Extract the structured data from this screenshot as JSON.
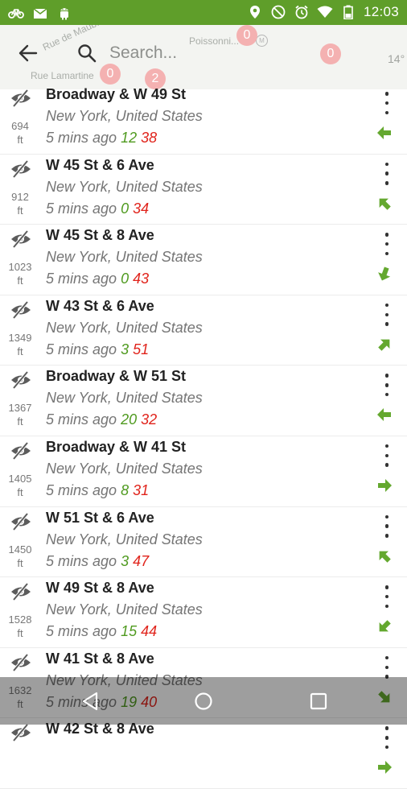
{
  "status_bar": {
    "time": "12:03",
    "bg_color": "#5f9e2a",
    "left_icons": [
      "bike-icon",
      "mail-icon",
      "android-icon"
    ],
    "right_icons": [
      "location-icon",
      "do-not-disturb-icon",
      "alarm-icon",
      "wifi-icon",
      "battery-icon"
    ]
  },
  "map_labels": {
    "street_1": "Rue de Maub...",
    "street_2": "Poissonni...",
    "street_3": "Rue Lamartine",
    "temperature": "14°",
    "bubbles": [
      "0",
      "0",
      "0",
      "2"
    ]
  },
  "search": {
    "placeholder": "Search..."
  },
  "colors": {
    "accent_green": "#4f9a1f",
    "accent_red": "#e0231b",
    "arrow_green": "#64a82f"
  },
  "stations": [
    {
      "name": "Broadway & W 49 St",
      "city": "New York, United States",
      "time": "5 mins ago",
      "bikes": "12",
      "docks": "38",
      "distance": "694",
      "unit": "ft",
      "arrow_rotation": 180
    },
    {
      "name": "W 45 St & 6 Ave",
      "city": "New York, United States",
      "time": "5 mins ago",
      "bikes": "0",
      "docks": "34",
      "distance": "912",
      "unit": "ft",
      "arrow_rotation": -135
    },
    {
      "name": "W 45 St & 8 Ave",
      "city": "New York, United States",
      "time": "5 mins ago",
      "bikes": "0",
      "docks": "43",
      "distance": "1023",
      "unit": "ft",
      "arrow_rotation": 110
    },
    {
      "name": "W 43 St & 6 Ave",
      "city": "New York, United States",
      "time": "5 mins ago",
      "bikes": "3",
      "docks": "51",
      "distance": "1349",
      "unit": "ft",
      "arrow_rotation": -45
    },
    {
      "name": "Broadway & W 51 St",
      "city": "New York, United States",
      "time": "5 mins ago",
      "bikes": "20",
      "docks": "32",
      "distance": "1367",
      "unit": "ft",
      "arrow_rotation": 180
    },
    {
      "name": "Broadway & W 41 St",
      "city": "New York, United States",
      "time": "5 mins ago",
      "bikes": "8",
      "docks": "31",
      "distance": "1405",
      "unit": "ft",
      "arrow_rotation": 0
    },
    {
      "name": "W 51 St & 6 Ave",
      "city": "New York, United States",
      "time": "5 mins ago",
      "bikes": "3",
      "docks": "47",
      "distance": "1450",
      "unit": "ft",
      "arrow_rotation": -135
    },
    {
      "name": "W 49 St & 8 Ave",
      "city": "New York, United States",
      "time": "5 mins ago",
      "bikes": "15",
      "docks": "44",
      "distance": "1528",
      "unit": "ft",
      "arrow_rotation": 135
    },
    {
      "name": "W 41 St & 8 Ave",
      "city": "New York, United States",
      "time": "5 mins ago",
      "bikes": "19",
      "docks": "40",
      "distance": "1632",
      "unit": "ft",
      "arrow_rotation": 45
    },
    {
      "name": "W 42 St & 8 Ave",
      "city": "",
      "time": "",
      "bikes": "",
      "docks": "",
      "distance": "",
      "unit": "",
      "arrow_rotation": 0
    }
  ]
}
